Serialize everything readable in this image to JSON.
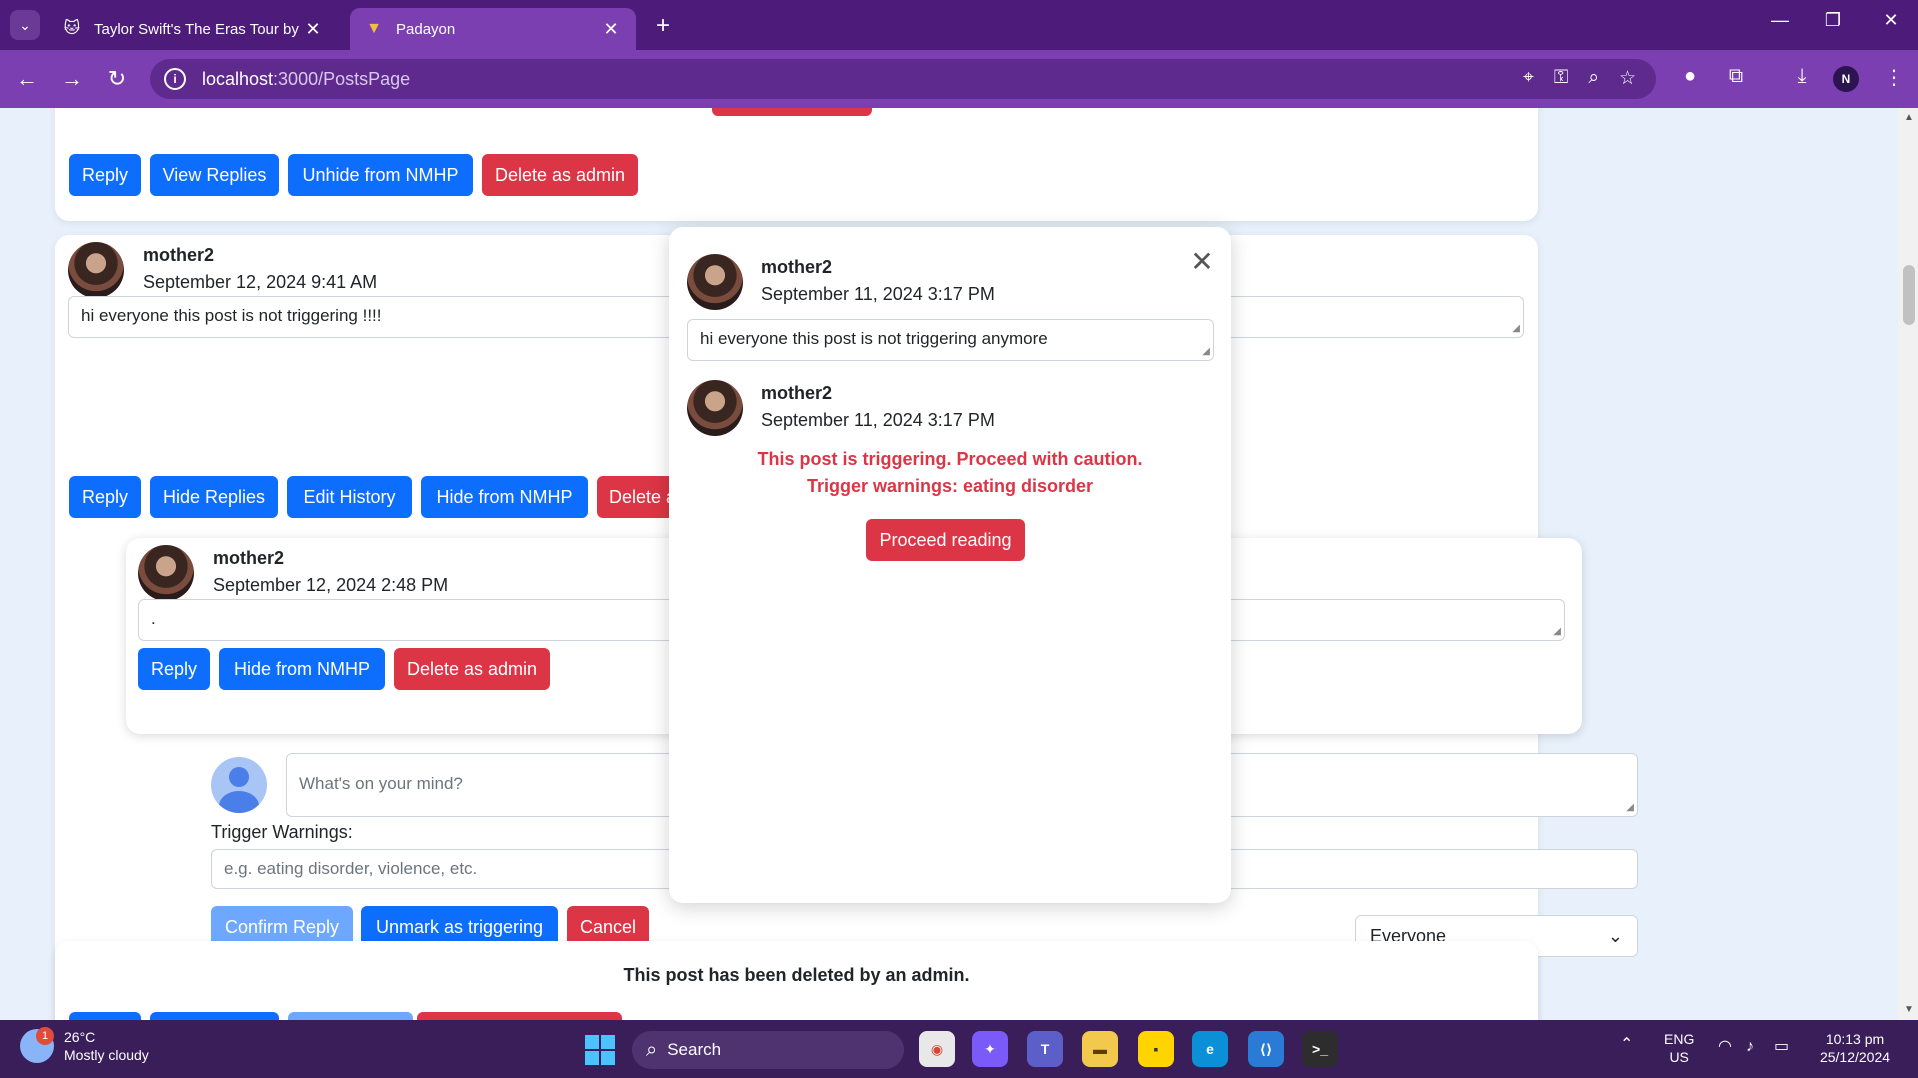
{
  "browser": {
    "tabs": [
      {
        "title": "Taylor Swift's The Eras Tour by N",
        "active": false
      },
      {
        "title": "Padayon",
        "active": true
      }
    ],
    "url_host": "localhost",
    "url_path": ":3000/PostsPage",
    "profile_initial": "N"
  },
  "post1": {
    "buttons": [
      "Reply",
      "View Replies",
      "Unhide from NMHP",
      "Delete as admin"
    ]
  },
  "post2": {
    "author": "mother2",
    "date": "September 12, 2024 9:41 AM",
    "content": "hi everyone this post is not triggering !!!!",
    "buttons": [
      "Reply",
      "Hide Replies",
      "Edit History",
      "Hide from NMHP",
      "Delete a"
    ]
  },
  "reply": {
    "author": "mother2",
    "date": "September 12, 2024 2:48 PM",
    "content": ".",
    "buttons": [
      "Reply",
      "Hide from NMHP",
      "Delete as admin"
    ]
  },
  "reply_form": {
    "placeholder": "What's on your mind?",
    "trigger_label": "Trigger Warnings:",
    "trigger_placeholder": "e.g. eating disorder, violence, etc.",
    "buttons": [
      "Confirm Reply",
      "Unmark as triggering",
      "Cancel"
    ],
    "audience": "Everyone"
  },
  "post3": {
    "deleted_text": "This post has been deleted by an admin."
  },
  "modal": {
    "entry1": {
      "author": "mother2",
      "date": "September 11, 2024 3:17 PM",
      "content": "hi everyone this post is not triggering anymore"
    },
    "entry2": {
      "author": "mother2",
      "date": "September 11, 2024 3:17 PM",
      "warning_line1": "This post is triggering. Proceed with caution.",
      "warning_line2": "Trigger warnings: eating disorder",
      "proceed_label": "Proceed reading"
    }
  },
  "taskbar": {
    "weather_temp": "26°C",
    "weather_desc": "Mostly cloudy",
    "weather_badge": "1",
    "search_label": "Search",
    "lang1": "ENG",
    "lang2": "US",
    "time": "10:13 pm",
    "date": "25/12/2024"
  },
  "colors": {
    "primary": "#0d6efd",
    "danger": "#dc3545",
    "chrome": "#7b3fb1"
  }
}
